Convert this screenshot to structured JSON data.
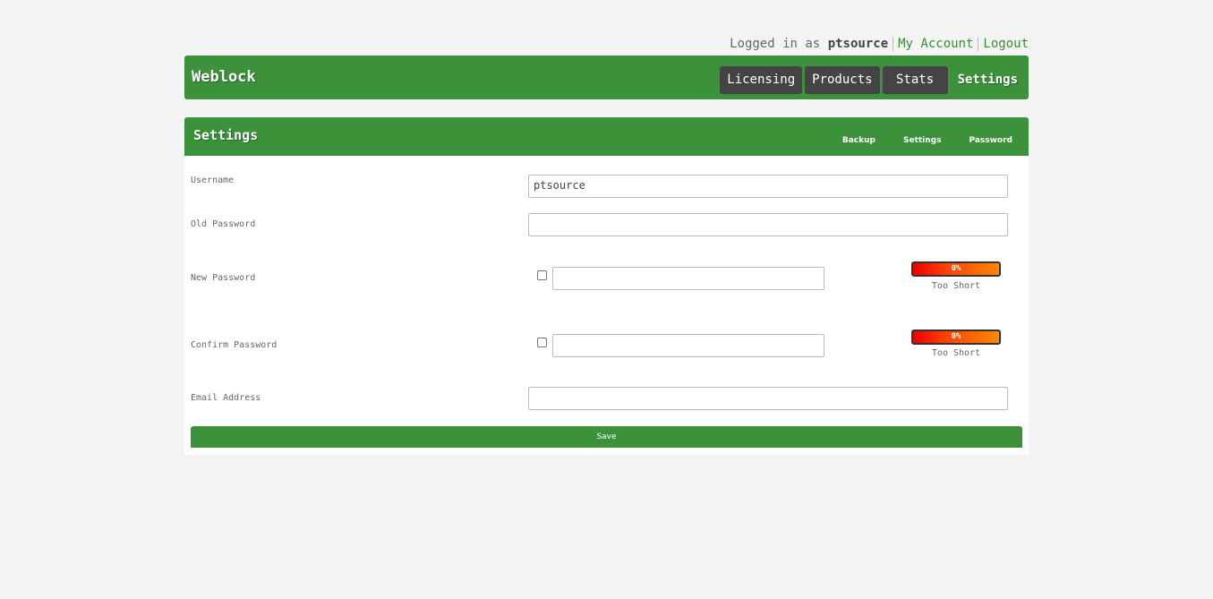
{
  "topbar": {
    "logged_in_prefix": "Logged in as",
    "username": "ptsource",
    "my_account": "My Account",
    "logout": "Logout"
  },
  "header": {
    "brand": "Weblock",
    "nav": [
      {
        "label": "Licensing"
      },
      {
        "label": "Products"
      },
      {
        "label": "Stats"
      },
      {
        "label": "Settings",
        "active": true
      }
    ]
  },
  "panel": {
    "title": "Settings",
    "subnav": [
      "Backup",
      "Settings",
      "Password"
    ]
  },
  "form": {
    "username_label": "Username",
    "username_value": "ptsource",
    "old_password_label": "Old Password",
    "new_password_label": "New Password",
    "confirm_password_label": "Confirm Password",
    "email_label": "Email Address",
    "new_strength": {
      "percent": "0%",
      "text": "Too Short"
    },
    "confirm_strength": {
      "percent": "0%",
      "text": "Too Short"
    },
    "save_label": "Save"
  },
  "colors": {
    "accent": "#3b923b",
    "nav_button": "#444444",
    "meter_low": "#ee0000"
  }
}
